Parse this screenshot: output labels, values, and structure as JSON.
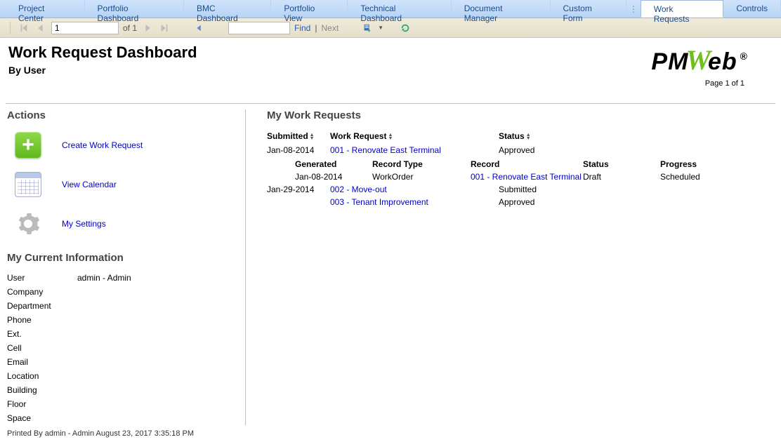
{
  "tabs": [
    "Project Center",
    "Portfolio Dashboard",
    "BMC Dashboard",
    "Portfolio View",
    "Technical Dashboard",
    "Document Manager",
    "Custom Form",
    "Work Requests",
    "Controls"
  ],
  "active_tab_index": 7,
  "toolbar": {
    "page_value": "1",
    "page_of_label": "of 1",
    "find_label": "Find",
    "next_label": "Next",
    "search_value": ""
  },
  "header": {
    "title": "Work Request Dashboard",
    "subtitle": "By User",
    "page_info": "Page 1 of 1"
  },
  "actions": {
    "title": "Actions",
    "items": [
      {
        "label": "Create Work Request"
      },
      {
        "label": "View Calendar"
      },
      {
        "label": "My Settings"
      }
    ]
  },
  "current_info": {
    "title": "My Current Information",
    "rows": [
      {
        "label": "User",
        "value": "admin - Admin"
      },
      {
        "label": "Company",
        "value": ""
      },
      {
        "label": "Department",
        "value": ""
      },
      {
        "label": "Phone",
        "value": ""
      },
      {
        "label": "Ext.",
        "value": ""
      },
      {
        "label": "Cell",
        "value": ""
      },
      {
        "label": "Email",
        "value": ""
      },
      {
        "label": "Location",
        "value": ""
      },
      {
        "label": "Building",
        "value": ""
      },
      {
        "label": "Floor",
        "value": ""
      },
      {
        "label": "Space",
        "value": ""
      }
    ]
  },
  "requests": {
    "title": "My Work Requests",
    "columns": {
      "submitted": "Submitted",
      "work_request": "Work Request",
      "status": "Status"
    },
    "child_columns": {
      "generated": "Generated",
      "record_type": "Record Type",
      "record": "Record",
      "status": "Status",
      "progress": "Progress"
    },
    "rows": [
      {
        "submitted": "Jan-08-2014",
        "work_request": "001 - Renovate East Terminal",
        "status": "Approved",
        "children": [
          {
            "generated": "Jan-08-2014",
            "record_type": "WorkOrder",
            "record": "001 - Renovate East Terminal",
            "status": "Draft",
            "progress": "Scheduled"
          }
        ]
      },
      {
        "submitted": "Jan-29-2014",
        "work_request": "002 - Move-out",
        "status": "Submitted",
        "children": []
      },
      {
        "submitted": "",
        "work_request": "003 - Tenant Improvement",
        "status": "Approved",
        "children": []
      }
    ]
  },
  "footer": "Printed By admin - Admin  August 23, 2017 3:35:18 PM"
}
